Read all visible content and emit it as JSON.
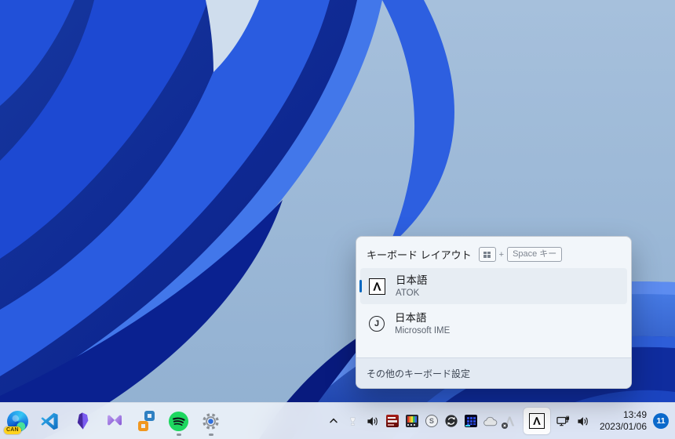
{
  "flyout": {
    "title": "キーボード レイアウト",
    "shortcut": {
      "plus": "+",
      "key_label": "Space キー"
    },
    "items": [
      {
        "label": "日本語",
        "sublabel": "ATOK",
        "selected": true
      },
      {
        "label": "日本語",
        "sublabel": "Microsoft IME",
        "selected": false,
        "icon_letter": "J"
      }
    ],
    "footer_link": "その他のキーボード設定"
  },
  "taskbar": {
    "apps": [
      "edge-canary",
      "vscode",
      "obsidian",
      "visual-studio",
      "vmware",
      "spotify",
      "settings"
    ],
    "running_apps": [
      "spotify",
      "settings"
    ],
    "edge_badge": "CAN",
    "tray": {
      "s_circle_letter": "S",
      "icons": [
        "chevron-up",
        "white-trumpet",
        "volume",
        "gpu-monitor",
        "color-palette",
        "s-circle",
        "sync",
        "grid-monitor",
        "cloud",
        "atok-disabled",
        "ime-atok",
        "network",
        "volume"
      ]
    },
    "clock": {
      "time": "13:49",
      "date": "2023/01/06"
    },
    "notification_count": "11"
  },
  "colors": {
    "accent": "#0067c0",
    "selected_item_bg": "#e7edf3",
    "flyout_bg": "#f2f6fa",
    "taskbar_bg": "#edf2f9",
    "desktop_light_blue": "#9cb9d8",
    "notification_badge": "#0b69cb",
    "spotify_green": "#1ed760"
  }
}
